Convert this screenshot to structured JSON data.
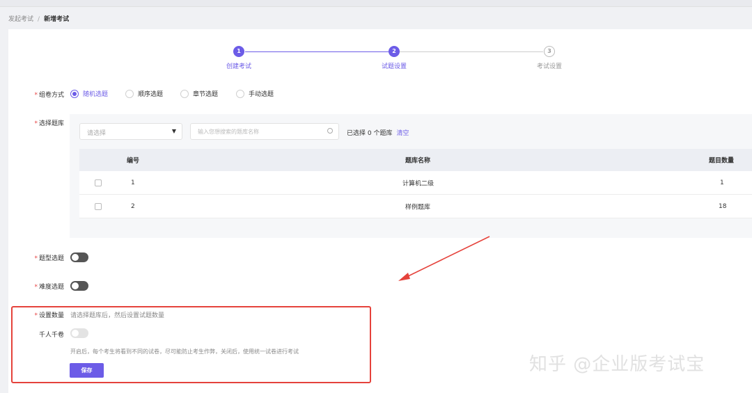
{
  "breadcrumb": {
    "parent": "发起考试",
    "separator": "/",
    "current": "新增考试"
  },
  "steps": [
    {
      "num": "1",
      "label": "创建考试",
      "state": "done"
    },
    {
      "num": "2",
      "label": "试题设置",
      "state": "done"
    },
    {
      "num": "3",
      "label": "考试设置",
      "state": "todo"
    }
  ],
  "form": {
    "compose_label": "组卷方式",
    "compose_options": [
      "随机选题",
      "顺序选题",
      "章节选题",
      "手动选题"
    ],
    "compose_selected": "随机选题",
    "bank_label": "选择题库",
    "bank_select_placeholder": "请选择",
    "bank_search_placeholder": "输入您想搜索的题库名称",
    "selected_info": "已选择 0 个题库",
    "clear_label": "清空",
    "table": {
      "headers": [
        "编号",
        "题库名称",
        "题目数量"
      ],
      "rows": [
        {
          "id": "1",
          "name": "计算机二级",
          "count": "1"
        },
        {
          "id": "2",
          "name": "样例题库",
          "count": "18"
        }
      ]
    },
    "type_select_label": "题型选题",
    "difficulty_select_label": "难度选题",
    "set_count_label": "设置数量",
    "set_count_hint": "请选择题库后，然后设置试题数量",
    "unique_paper_label": "千人千卷",
    "unique_paper_hint": "开启后，每个考生将看到不同的试卷，尽可能防止考生作弊，关闭后，使用统一试卷进行考试",
    "save_label": "保存",
    "required_mark": "*"
  },
  "watermark": "知乎 @企业版考试宝",
  "colors": {
    "accent": "#6c5ce7",
    "annotation": "#e5423b"
  }
}
